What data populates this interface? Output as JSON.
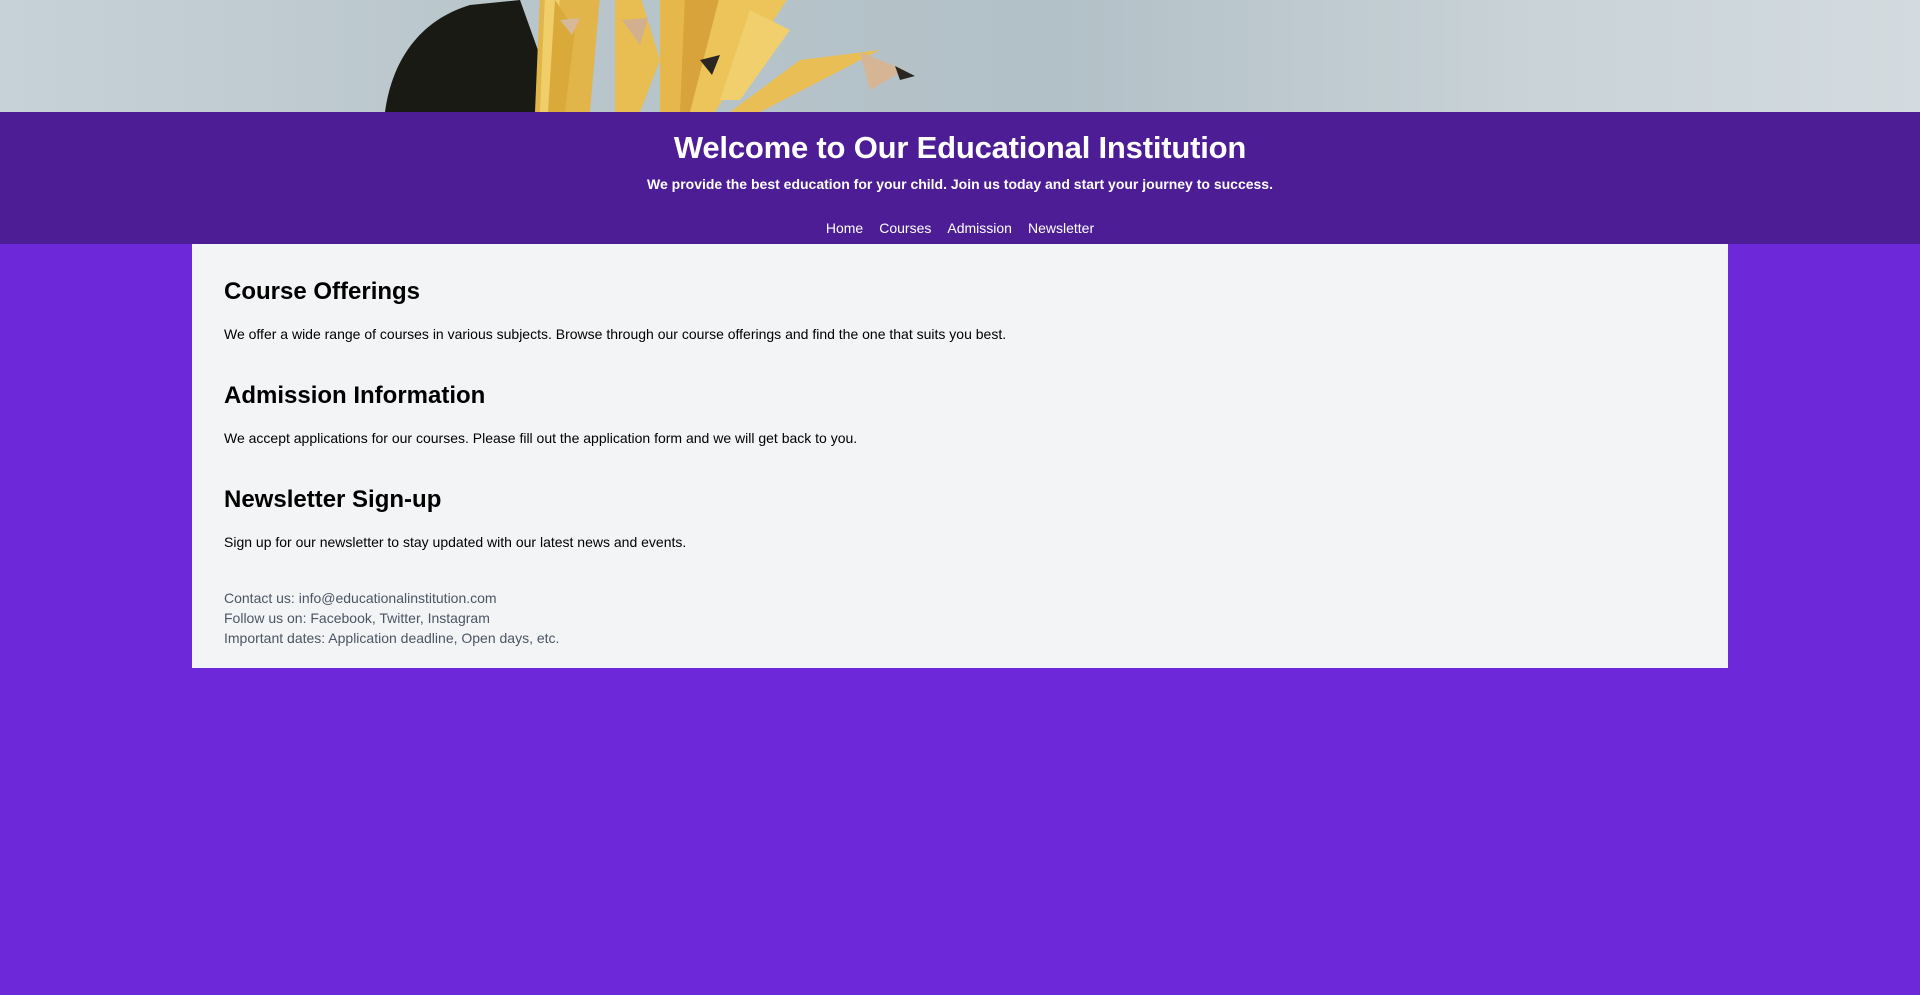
{
  "header": {
    "title": "Welcome to Our Educational Institution",
    "subtitle": "We provide the best education for your child. Join us today and start your journey to success."
  },
  "nav": {
    "items": [
      {
        "label": "Home"
      },
      {
        "label": "Courses"
      },
      {
        "label": "Admission"
      },
      {
        "label": "Newsletter"
      }
    ]
  },
  "sections": [
    {
      "heading": "Course Offerings",
      "text": "We offer a wide range of courses in various subjects. Browse through our course offerings and find the one that suits you best."
    },
    {
      "heading": "Admission Information",
      "text": "We accept applications for our courses. Please fill out the application form and we will get back to you."
    },
    {
      "heading": "Newsletter Sign-up",
      "text": "Sign up for our newsletter to stay updated with our latest news and events."
    }
  ],
  "footer": {
    "contact": "Contact us: info@educationalinstitution.com",
    "social": "Follow us on: Facebook, Twitter, Instagram",
    "dates": "Important dates: Application deadline, Open days, etc."
  },
  "colors": {
    "page_background": "#6d28d9",
    "header_background": "#4c1d95",
    "content_background": "#f3f4f6"
  },
  "hero_image": "pencils-in-cup-photo"
}
